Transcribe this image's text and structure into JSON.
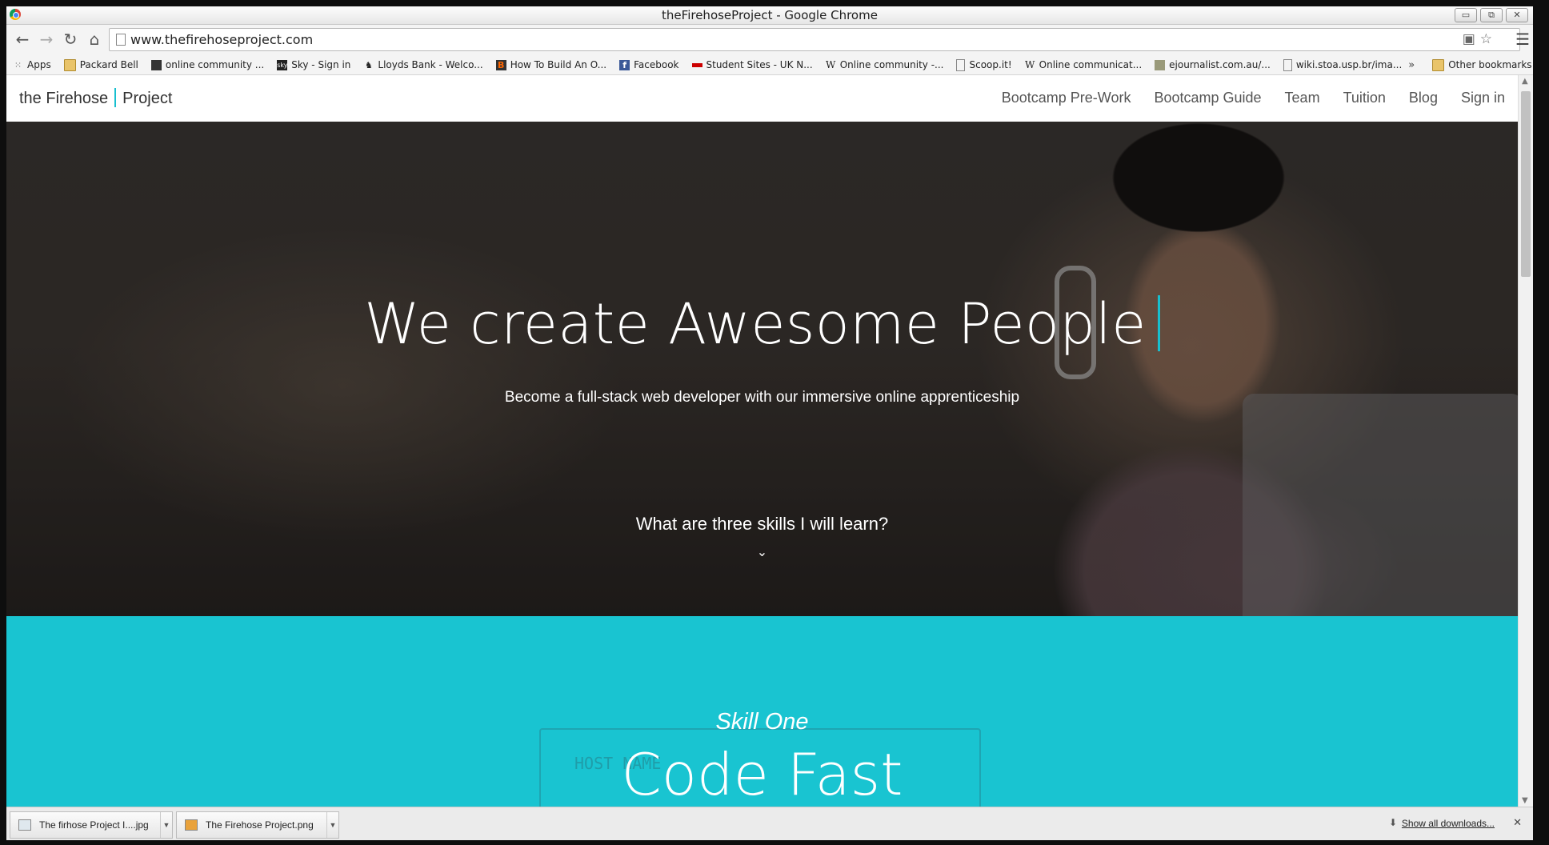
{
  "window": {
    "title": "theFirehoseProject - Google Chrome",
    "controls": [
      "▭",
      "⧉",
      "✕"
    ]
  },
  "toolbar": {
    "back": "←",
    "forward": "→",
    "reload": "↻",
    "home": "⌂",
    "url": "www.thefirehoseproject.com",
    "menu": "☰"
  },
  "bookmarks": {
    "items": [
      {
        "label": "Apps",
        "icon": "apps-grid-icon"
      },
      {
        "label": "Packard Bell",
        "icon": "folder-icon"
      },
      {
        "label": "online community ...",
        "icon": "page-icon"
      },
      {
        "label": "Sky - Sign in",
        "icon": "sky-icon"
      },
      {
        "label": "Lloyds Bank - Welco...",
        "icon": "lloyds-icon"
      },
      {
        "label": "How To Build An O...",
        "icon": "blogger-icon"
      },
      {
        "label": "Facebook",
        "icon": "facebook-icon"
      },
      {
        "label": "Student Sites - UK N...",
        "icon": "student-sites-icon"
      },
      {
        "label": "Online community -...",
        "icon": "wikipedia-icon"
      },
      {
        "label": "Scoop.it!",
        "icon": "page-icon"
      },
      {
        "label": "Online communicat...",
        "icon": "wikipedia-icon"
      },
      {
        "label": "ejournalist.com.au/...",
        "icon": "page-icon"
      },
      {
        "label": "wiki.stoa.usp.br/ima...",
        "icon": "page-icon"
      }
    ],
    "more": "»",
    "other": "Other bookmarks"
  },
  "site": {
    "logo_left": "the Firehose",
    "logo_right": "Project",
    "nav": [
      "Bootcamp Pre-Work",
      "Bootcamp Guide",
      "Team",
      "Tuition",
      "Blog",
      "Sign in"
    ]
  },
  "hero": {
    "title": "We create Awesome People",
    "subtitle": "Become a full-stack web developer with our immersive online apprenticeship",
    "question": "What are three skills I will learn?",
    "chevron": "⌄"
  },
  "skill": {
    "label": "Skill One",
    "title": "Code Fast",
    "sketch_text": "HOST NAME"
  },
  "downloads": {
    "items": [
      "The firhose Project I....jpg",
      "The Firehose Project.png"
    ],
    "show_all": "Show all downloads...",
    "close": "✕"
  },
  "colors": {
    "accent": "#17bfcf",
    "skill_bg": "#19c4d1"
  }
}
